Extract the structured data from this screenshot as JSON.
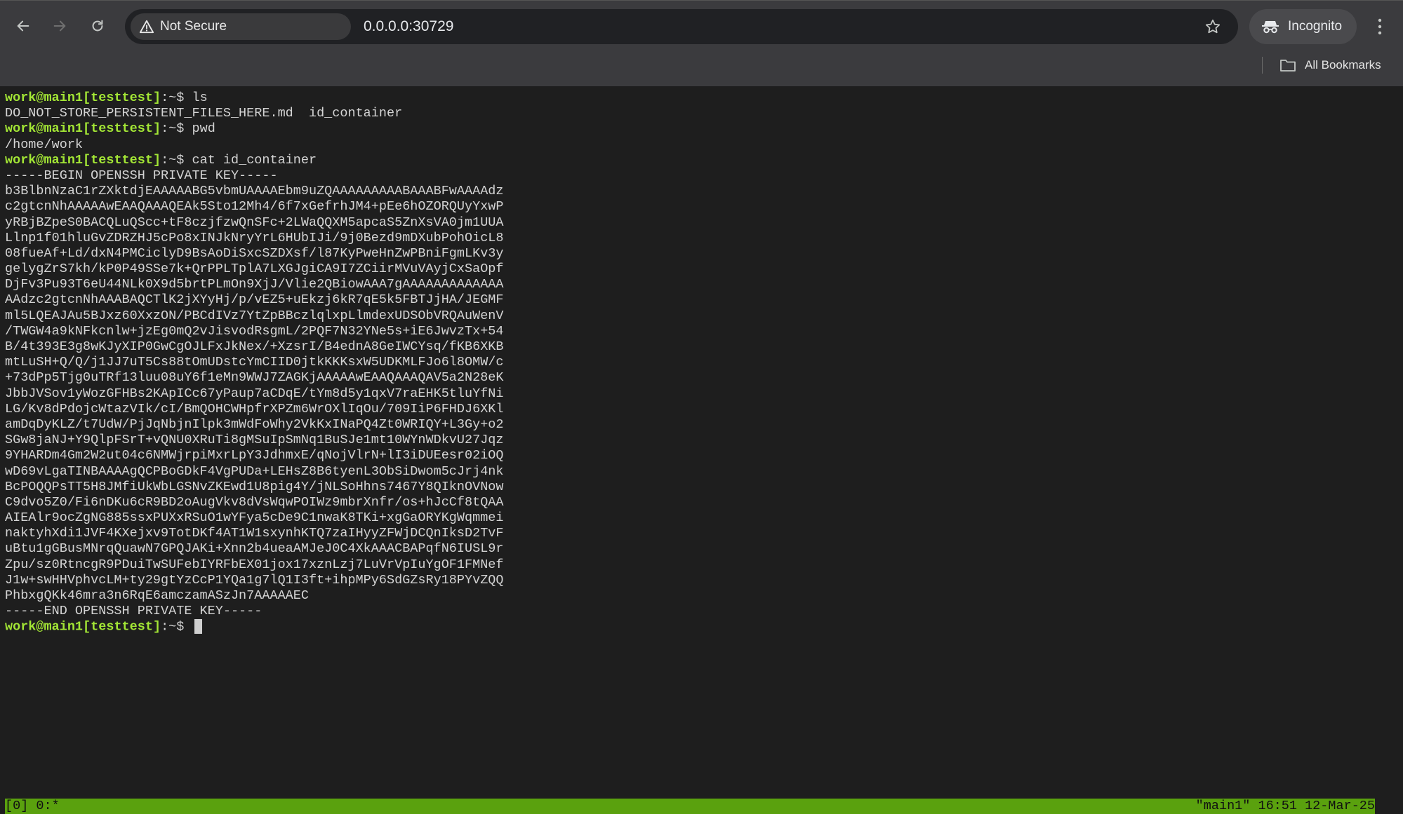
{
  "browser": {
    "security_label": "Not Secure",
    "url": "0.0.0.0:30729",
    "incognito_label": "Incognito",
    "bookmarks_label": "All Bookmarks"
  },
  "terminal": {
    "prompt": {
      "user": "work@main1",
      "bracket": "[testtest]",
      "path": ":~$ "
    },
    "blocks": [
      {
        "cmd": "ls",
        "output": [
          "DO_NOT_STORE_PERSISTENT_FILES_HERE.md  id_container"
        ]
      },
      {
        "cmd": "pwd",
        "output": [
          "/home/work"
        ]
      },
      {
        "cmd": "cat id_container",
        "output": [
          "-----BEGIN OPENSSH PRIVATE KEY-----",
          "b3BlbnNzaC1rZXktdjEAAAAABG5vbmUAAAAEbm9uZQAAAAAAAAABAAABFwAAAAdz",
          "c2gtcnNhAAAAAwEAAQAAAQEAk5Sto12Mh4/6f7xGefrhJM4+pEe6hOZORQUyYxwP",
          "yRBjBZpeS0BACQLuQScc+tF8czjfzwQnSFc+2LWaQQXM5apcaS5ZnXsVA0jm1UUA",
          "Llnp1f01hluGvZDRZHJ5cPo8xINJkNryYrL6HUbIJi/9j0Bezd9mDXubPohOicL8",
          "08fueAf+Ld/dxN4PMCiclyD9BsAoDiSxcSZDXsf/l87KyPweHnZwPBniFgmLKv3y",
          "gelygZrS7kh/kP0P49SSe7k+QrPPLTplA7LXGJgiCA9I7ZCiirMVuVAyjCxSaOpf",
          "DjFv3Pu93T6eU44NLk0X9d5brtPLmOn9XjJ/Vlie2QBiowAAA7gAAAAAAAAAAAAA",
          "AAdzc2gtcnNhAAABAQCTlK2jXYyHj/p/vEZ5+uEkzj6kR7qE5k5FBTJjHA/JEGMF",
          "ml5LQEAJAu5BJxz60XxzON/PBCdIVz7YtZpBBczlqlxpLlmdexUDSObVRQAuWenV",
          "/TWGW4a9kNFkcnlw+jzEg0mQ2vJisvodRsgmL/2PQF7N32YNe5s+iE6JwvzTx+54",
          "B/4t393E3g8wKJyXIP0GwCgOJLFxJkNex/+XzsrI/B4ednA8GeIWCYsq/fKB6XKB",
          "mtLuSH+Q/Q/j1JJ7uT5Cs88tOmUDstcYmCIID0jtkKKKsxW5UDKMLFJo6l8OMW/c",
          "+73dPp5Tjg0uTRf13luu08uY6f1eMn9WWJ7ZAGKjAAAAAwEAAQAAAQAV5a2N28eK",
          "JbbJVSov1yWozGFHBs2KApICc67yPaup7aCDqE/tYm8d5y1qxV7raEHK5tluYfNi",
          "LG/Kv8dPdojcWtazVIk/cI/BmQOHCWHpfrXPZm6WrOXlIqOu/709IiP6FHDJ6XKl",
          "amDqDyKLZ/t7UdW/PjJqNbjnIlpk3mWdFoWhy2VkKxINaPQ4Zt0WRIQY+L3Gy+o2",
          "SGw8jaNJ+Y9QlpFSrT+vQNU0XRuTi8gMSuIpSmNq1BuSJe1mt10WYnWDkvU27Jqz",
          "9YHARDm4Gm2W2ut04c6NMWjrpiMxrLpY3JdhmxE/qNojVlrN+lI3iDUEesr02iOQ",
          "wD69vLgaTINBAAAAgQCPBoGDkF4VgPUDa+LEHsZ8B6tyenL3ObSiDwom5cJrj4nk",
          "BcPOQQPsTT5H8JMfiUkWbLGSNvZKEwd1U8pig4Y/jNLSoHhns7467Y8QIknOVNow",
          "C9dvo5Z0/Fi6nDKu6cR9BD2oAugVkv8dVsWqwPOIWz9mbrXnfr/os+hJcCf8tQAA",
          "AIEAlr9ocZgNG885ssxPUXxRSuO1wYFya5cDe9C1nwaK8TKi+xgGaORYKgWqmmei",
          "naktyhXdi1JVF4KXejxv9TotDKf4AT1W1sxynhKTQ7zaIHyyZFWjDCQnIksD2TvF",
          "uBtu1gGBusMNrqQuawN7GPQJAKi+Xnn2b4ueaAMJeJ0C4XkAAACBAPqfN6IUSL9r",
          "Zpu/sz0RtncgR9PDuiTwSUFebIYRFbEX01jox17xznLzj7LuVrVpIuYgOF1FMNef",
          "J1w+swHHVphvcLM+ty29gtYzCcP1YQa1g7lQ1I3ft+ihpMPy6SdGZsRy18PYvZQQ",
          "PhbxgQKk46mra3n6RqE6amczamASzJn7AAAAAEC",
          "-----END OPENSSH PRIVATE KEY-----"
        ]
      }
    ],
    "status": {
      "left": "[0] 0:*",
      "right": "\"main1\" 16:51 12-Mar-25"
    }
  }
}
